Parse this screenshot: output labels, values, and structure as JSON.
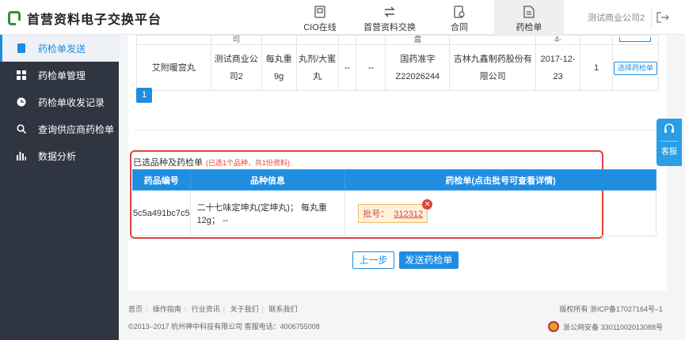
{
  "app": {
    "title": "首营资料电子交换平台"
  },
  "nav": {
    "items": [
      {
        "label": "CIO在线",
        "icon": "document-icon"
      },
      {
        "label": "首营资料交换",
        "icon": "exchange-icon"
      },
      {
        "label": "合同",
        "icon": "contract-icon"
      },
      {
        "label": "药检单",
        "icon": "report-icon"
      }
    ],
    "active": "药检单",
    "company": "测试商业公司2"
  },
  "sidebar": {
    "items": [
      {
        "label": "药检单发送",
        "icon": "file-icon"
      },
      {
        "label": "药检单管理",
        "icon": "grid-icon"
      },
      {
        "label": "药检单收发记录",
        "icon": "clock-icon"
      },
      {
        "label": "查询供应商药检单",
        "icon": "search-icon"
      },
      {
        "label": "数据分析",
        "icon": "bar-chart-icon"
      }
    ],
    "active": "药检单发送"
  },
  "top_table": {
    "cut_row": [
      "司",
      "",
      "",
      "",
      "",
      "盒",
      "",
      "",
      "",
      "",
      "4-",
      ""
    ],
    "row": {
      "name": "艾附暖宫丸",
      "company": "测试商业公司2",
      "spec": "每丸重9g",
      "form": "丸剂/大蜜丸",
      "col5": "--",
      "col6": "--",
      "approval": "国药准字Z22026244",
      "manufacturer": "吉林九鑫制药股份有限公司",
      "date": "2017-12-23",
      "count": "1",
      "action": "选择药检单"
    }
  },
  "pagination": {
    "current": "1"
  },
  "selected": {
    "title": "已选品种及药检单",
    "note": "(已选1个品种，共1份资料)",
    "headers": [
      "药品编号",
      "品种信息",
      "药检单(点击批号可查看详情)"
    ],
    "rows": [
      {
        "code": "5c5a491bc7c5",
        "info": "二十七味定坤丸(定坤丸)； 每丸重12g； --",
        "lot_label": "批号：",
        "lot_number": "312312"
      }
    ]
  },
  "buttons": {
    "prev": "上一步",
    "send": "发送药检单"
  },
  "footer": {
    "links": [
      "首页",
      "操作指南",
      "行业资讯",
      "关于我们",
      "联系我们"
    ],
    "copyright": "©2013–2017 杭州神中科技有限公司 客服电话：4006755008",
    "icp": "版权所有 浙ICP备17027164号–1",
    "police": "浙公网安备 33011002013088号"
  },
  "service": {
    "label": "客服"
  }
}
